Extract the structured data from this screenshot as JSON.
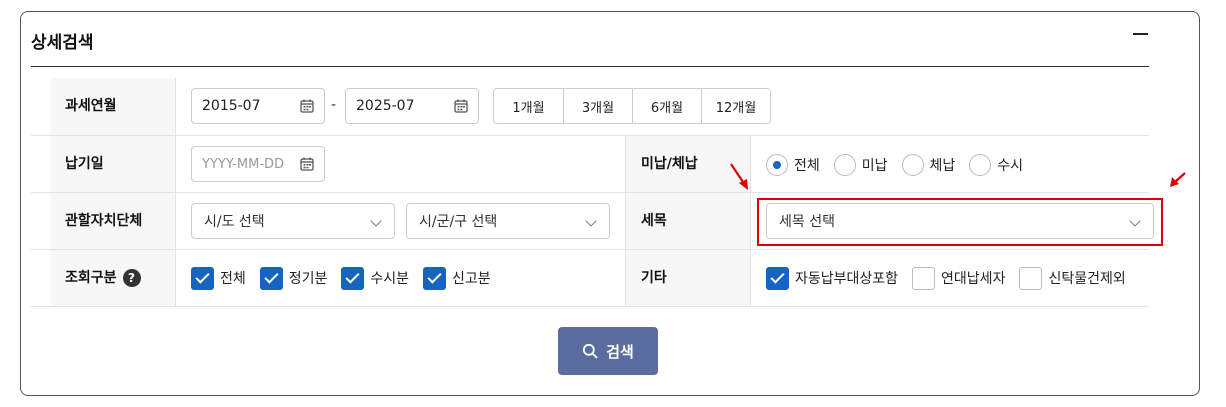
{
  "panel": {
    "title": "상세검색"
  },
  "rows": {
    "period": {
      "label": "과세연월",
      "from": "2015-07",
      "separator": "-",
      "to": "2025-07",
      "buttons": [
        "1개월",
        "3개월",
        "6개월",
        "12개월"
      ]
    },
    "due_date": {
      "label": "납기일",
      "placeholder": "YYYY-MM-DD"
    },
    "unpaid": {
      "label": "미납/체납",
      "options": [
        "전체",
        "미납",
        "체납",
        "수시"
      ],
      "selected": "전체"
    },
    "region": {
      "label": "관할자치단체",
      "sido": "시/도 선택",
      "sigungu": "시/군/구 선택"
    },
    "tax_item": {
      "label": "세목",
      "value": "세목 선택"
    },
    "inquiry_type": {
      "label": "조회구분",
      "help": "?",
      "options": [
        "전체",
        "정기분",
        "수시분",
        "신고분"
      ]
    },
    "etc": {
      "label": "기타",
      "options": [
        "자동납부대상포함",
        "연대납세자",
        "신탁물건제외"
      ]
    }
  },
  "search": {
    "label": "검색"
  },
  "colors": {
    "accent": "#1565c0",
    "button": "#5b6d9e",
    "highlight": "#e00000"
  }
}
